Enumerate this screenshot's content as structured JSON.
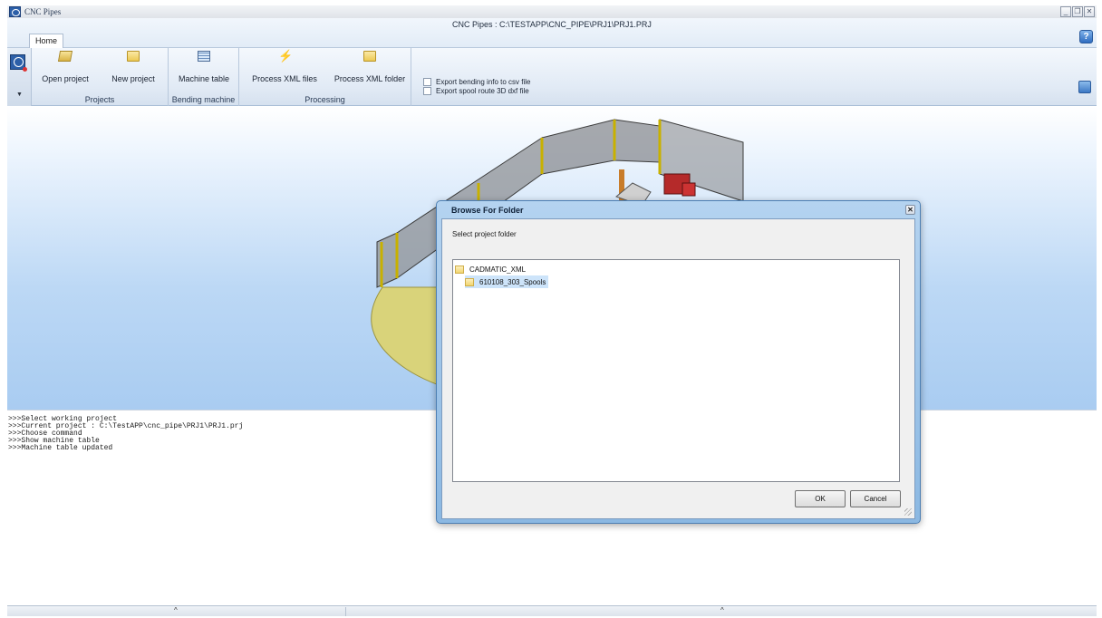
{
  "app": {
    "name": "CNC Pipes",
    "window_title": "CNC Pipes : C:\\TESTAPP\\CNC_PIPE\\PRJ1\\PRJ1.PRJ",
    "window_buttons": [
      "_",
      "❐",
      "✕"
    ]
  },
  "ribbon": {
    "tab": "Home",
    "help_label": "?",
    "groups": [
      {
        "label": "Projects",
        "buttons": [
          {
            "label": "Open project",
            "icon": "folder-open-icon"
          },
          {
            "label": "New project",
            "icon": "folder-icon"
          }
        ]
      },
      {
        "label": "Bending machine",
        "buttons": [
          {
            "label": "Machine table",
            "icon": "table-icon"
          }
        ]
      },
      {
        "label": "Processing",
        "buttons": [
          {
            "label": "Process XML files",
            "icon": "xml-process-icon"
          },
          {
            "label": "Process XML folder",
            "icon": "folder-icon"
          }
        ]
      }
    ],
    "options": [
      {
        "label": "Export bending info to csv file",
        "checked": false
      },
      {
        "label": "Export  spool route 3D dxf file",
        "checked": false
      }
    ]
  },
  "log": {
    "lines": [
      ">>>Select working project",
      ">>>Current project : C:\\TestAPP\\cnc_pipe\\PRJ1\\PRJ1.prj",
      ">>>Choose command",
      ">>>Show machine table",
      ">>>Machine table updated"
    ]
  },
  "statusbar": {
    "caret": "^"
  },
  "dialog": {
    "title": "Browse For Folder",
    "close_label": "✕",
    "prompt": "Select project folder",
    "tree": [
      {
        "label": "CADMATIC_XML",
        "level": 0,
        "selected": false
      },
      {
        "label": "610108_303_Spools",
        "level": 1,
        "selected": true
      }
    ],
    "ok_label": "OK",
    "cancel_label": "Cancel"
  }
}
